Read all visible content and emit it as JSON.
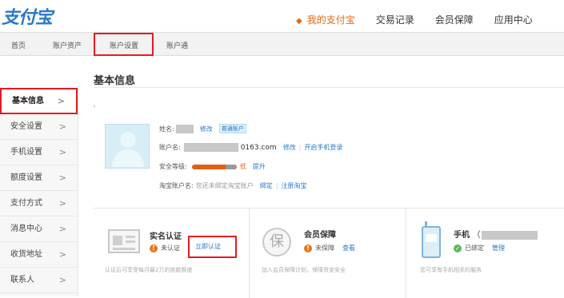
{
  "brand": {
    "logo_text": "支付宝"
  },
  "topnav": {
    "items": [
      {
        "label": "我的支付宝",
        "active": true
      },
      {
        "label": "交易记录"
      },
      {
        "label": "会员保障"
      },
      {
        "label": "应用中心"
      }
    ]
  },
  "subnav": {
    "items": [
      "首页",
      "账户资产",
      "账户设置",
      "账户通"
    ]
  },
  "sidebar": {
    "items": [
      {
        "label": "基本信息",
        "active": true
      },
      {
        "label": "安全设置"
      },
      {
        "label": "手机设置"
      },
      {
        "label": "额度设置"
      },
      {
        "label": "支付方式"
      },
      {
        "label": "消息中心"
      },
      {
        "label": "收货地址"
      },
      {
        "label": "联系人"
      }
    ],
    "arrow": ">"
  },
  "main": {
    "title": "基本信息",
    "profile": {
      "name_label": "姓名:",
      "name_edit": "修改",
      "name_tag": "普通账户",
      "account_label": "账户名:",
      "account_suffix": "0163.com",
      "account_edit": "修改",
      "account_sep": "|",
      "account_mobile_login": "开启手机登录",
      "security_label": "安全等级:",
      "security_level": "低",
      "security_upgrade": "提升",
      "taobao_label": "淘宝账户名:",
      "taobao_text": "您还未绑定淘宝账户",
      "taobao_bind": "绑定",
      "taobao_sep": "|",
      "taobao_register": "注册淘宝"
    },
    "cards": [
      {
        "title": "实名认证",
        "status": "未认证",
        "action": "立即认证",
        "desc": "认证后可享受每月最2万的收款额度"
      },
      {
        "title": "会员保障",
        "status": "未保障",
        "action": "查看",
        "desc": "加入会员保障计划，保障资金安全"
      },
      {
        "title": "手机",
        "title_suffix": "（",
        "status": "已绑定",
        "action": "管理",
        "desc": "您可享有手机相关的服务"
      }
    ]
  },
  "icons": {
    "warn_glyph": "!",
    "ok_glyph": "✓",
    "shield_glyph": "保"
  },
  "colors": {
    "brand_blue": "#2a79c8",
    "accent_orange": "#e8680c",
    "highlight_red": "#e31b23"
  }
}
